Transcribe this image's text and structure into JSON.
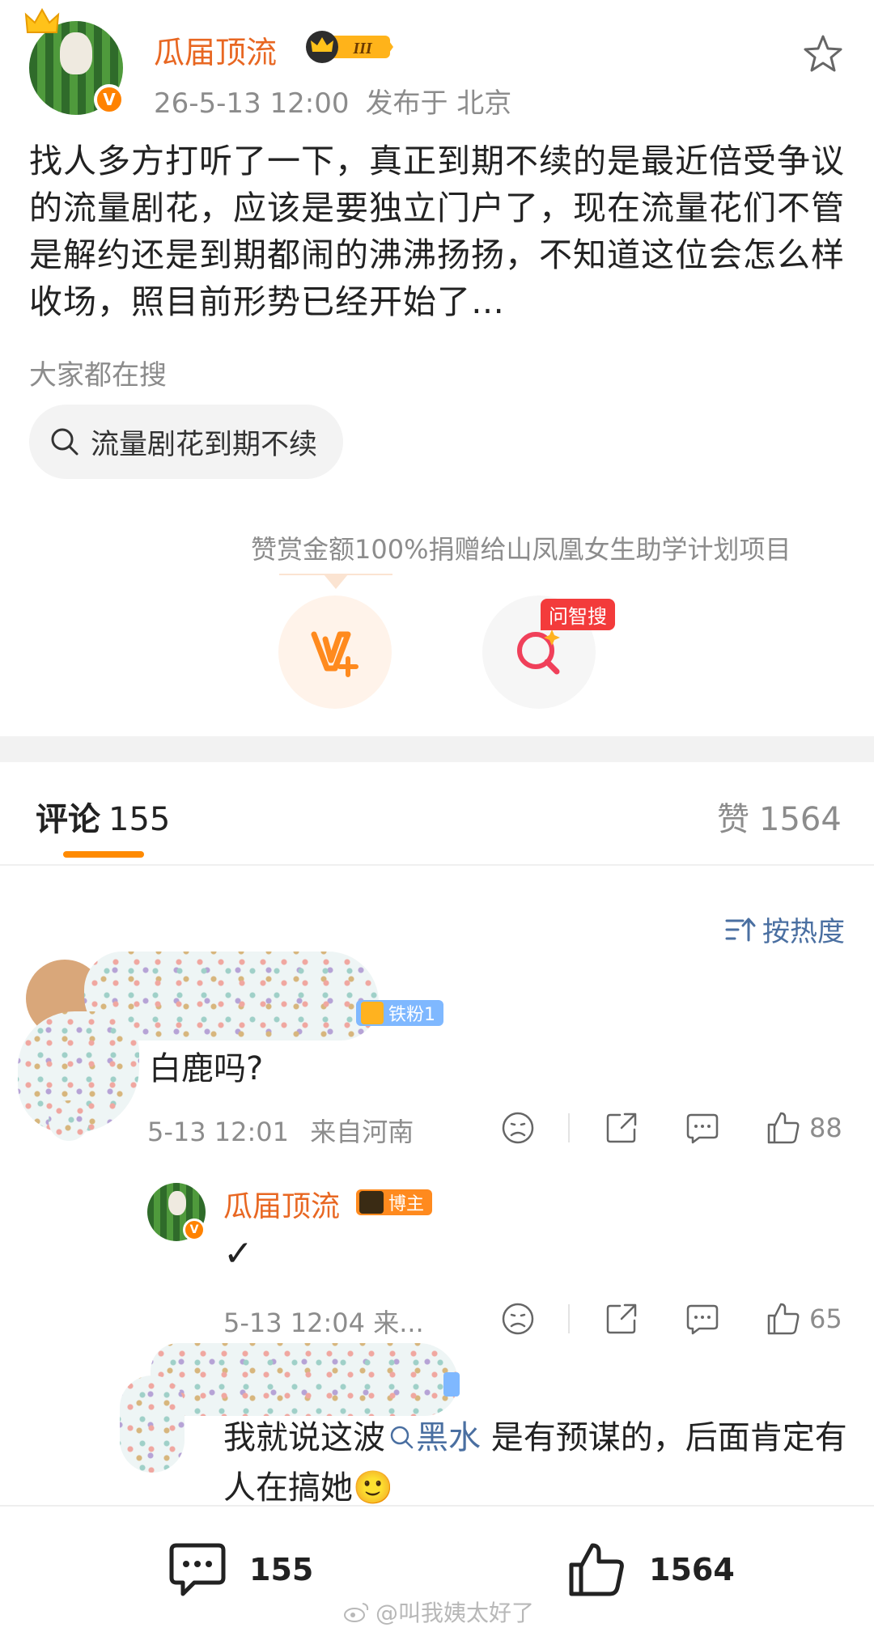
{
  "post": {
    "author": "瓜届顶流",
    "level": "III",
    "time": "26-5-13 12:00",
    "location": "发布于 北京",
    "body": "找人多方打听了一下，真正到期不续的是最近倍受争议的流量剧花，应该是要独立门户了，现在流量花们不管是解约还是到期都闹的沸沸扬扬，不知道这位会怎么样收场，照目前形势已经开始了…",
    "hot_search_title": "大家都在搜",
    "hot_search_query": "流量剧花到期不续",
    "reward_note": "赞赏金额100%捐赠给山凤凰女生助学计划项目",
    "ask_tag": "问智搜"
  },
  "tabs": {
    "comments_label": "评论",
    "comments_count": "155",
    "likes_label": "赞",
    "likes_count": "1564"
  },
  "sort_label": "按热度",
  "comments": [
    {
      "badge": "铁粉1",
      "text": "白鹿吗?",
      "time": "5-13 12:01",
      "location": "来自河南",
      "likes": "88"
    },
    {
      "author": "瓜届顶流",
      "badge": "博主",
      "text": "✓",
      "meta": "5-13 12:04 来...",
      "likes": "65"
    },
    {
      "text_before": "我就说这波",
      "topic": "黑水",
      "text_after": "是有预谋的，后面肯定有人在搞她🙂"
    }
  ],
  "bottom_bar": {
    "comments": "155",
    "likes": "1564",
    "watermark": "@叫我姨太好了"
  },
  "colors": {
    "brand_orange": "#e86722",
    "accent": "#ff8a00",
    "link_blue": "#4a6fa1",
    "meta_gray": "#8c8c8c"
  }
}
